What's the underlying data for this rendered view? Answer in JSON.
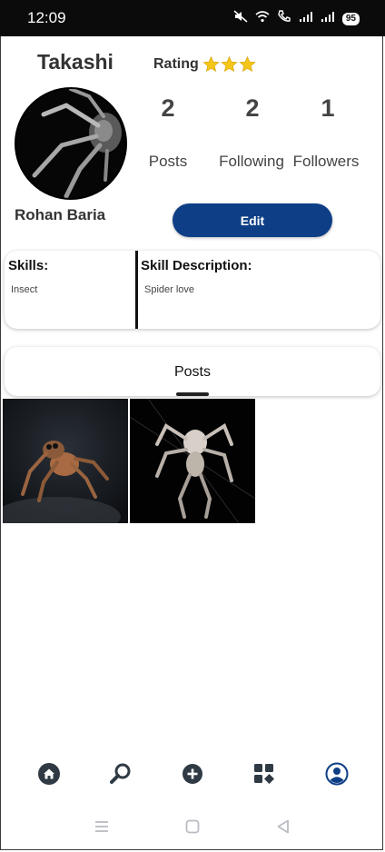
{
  "status_bar": {
    "time": "12:09",
    "battery": "95"
  },
  "profile": {
    "username": "Takashi",
    "rating_label": "Rating",
    "rating_stars": 3,
    "display_name": "Rohan Baria",
    "edit_label": "Edit"
  },
  "stats": [
    {
      "value": "2",
      "label": "Posts"
    },
    {
      "value": "2",
      "label": "Following"
    },
    {
      "value": "1",
      "label": "Followers"
    }
  ],
  "skills_card": {
    "skills_heading": "Skills:",
    "skills_value": "Insect",
    "description_heading": "Skill Description:",
    "description_value": "Spider love"
  },
  "posts_tab": {
    "label": "Posts"
  },
  "posts": [
    {
      "subject": "jumping spider photo"
    },
    {
      "subject": "white spider photo"
    }
  ],
  "bottom_nav": [
    {
      "icon": "home-icon"
    },
    {
      "icon": "search-icon"
    },
    {
      "icon": "add-icon"
    },
    {
      "icon": "dashboard-icon"
    },
    {
      "icon": "profile-icon"
    }
  ],
  "colors": {
    "accent": "#0e3f86",
    "star": "#f5c518",
    "nav_icon": "#2f3a44",
    "active_nav": "#0e3f86"
  }
}
